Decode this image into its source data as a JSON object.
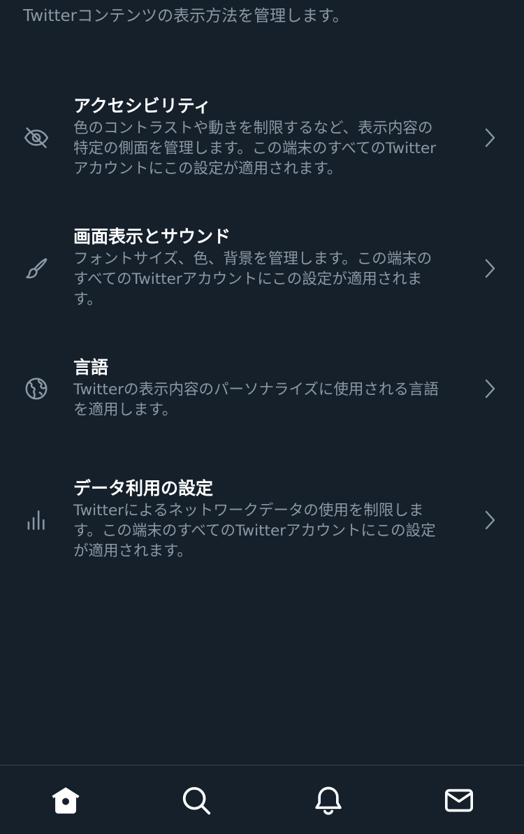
{
  "header": {
    "description": "Twitterコンテンツの表示方法を管理します。"
  },
  "settings_items": [
    {
      "icon": "eye-slash-icon",
      "title": "アクセシビリティ",
      "description_lines": [
        "色のコントラストや動きを制限するなど、表示内容の",
        "特定の側面を管理します。この端末のすべてのTwitter",
        "アカウントにこの設定が適用されます。"
      ]
    },
    {
      "icon": "paintbrush-icon",
      "title": "画面表示とサウンド",
      "description_lines": [
        "フォントサイズ、色、背景を管理します。この端末の",
        "すべてのTwitterアカウントにこの設定が適用されま",
        "す。"
      ]
    },
    {
      "icon": "globe-icon",
      "title": "言語",
      "description_lines": [
        "Twitterの表示内容のパーソナライズに使用される言語",
        "を適用します。"
      ]
    },
    {
      "icon": "bar-chart-icon",
      "title": "データ利用の設定",
      "description_lines": [
        "Twitterによるネットワークデータの使用を制限しま",
        "す。この端末のすべてのTwitterアカウントにこの設定",
        "が適用されます。"
      ]
    }
  ],
  "tabbar": {
    "tabs": [
      {
        "icon": "home-icon",
        "active": true
      },
      {
        "icon": "search-icon",
        "active": false
      },
      {
        "icon": "bell-icon",
        "active": false
      },
      {
        "icon": "mail-icon",
        "active": false
      }
    ]
  },
  "colors": {
    "background": "#15202b",
    "text_primary": "#ffffff",
    "text_secondary": "#8b98a5",
    "divider": "#38444d"
  }
}
